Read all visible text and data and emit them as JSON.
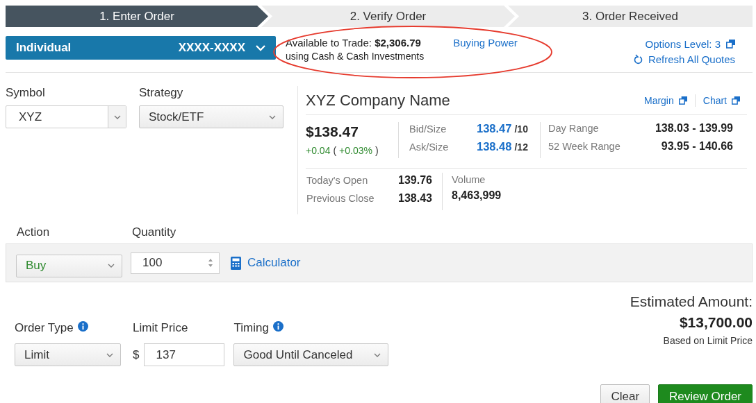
{
  "steps": [
    {
      "label": "1. Enter Order",
      "selected": true
    },
    {
      "label": "2. Verify Order",
      "selected": false
    },
    {
      "label": "3. Order Received",
      "selected": false
    }
  ],
  "account": {
    "type": "Individual",
    "number": "XXXX-XXXX"
  },
  "available": {
    "label": "Available to Trade:",
    "amount": "$2,306.79",
    "note": "using Cash & Cash Investments",
    "link": "Buying Power"
  },
  "options_level": "Options Level: 3",
  "refresh": "Refresh All Quotes",
  "symbol": {
    "label": "Symbol",
    "value": "XYZ"
  },
  "strategy": {
    "label": "Strategy",
    "value": "Stock/ETF"
  },
  "quote": {
    "name": "XYZ Company Name",
    "links": [
      "Margin",
      "Chart"
    ],
    "price": "$138.47",
    "change": "+0.04",
    "paren_open": "(",
    "change_pct": "+0.03%",
    "paren_close": ")",
    "bid_ask": [
      {
        "label": "Bid/Size",
        "price": "138.47",
        "size": "/10"
      },
      {
        "label": "Ask/Size",
        "price": "138.48",
        "size": "/12"
      }
    ],
    "ranges": [
      {
        "label": "Day Range",
        "value": "138.03 - 139.99"
      },
      {
        "label": "52 Week Range",
        "value": "93.95 - 140.66"
      }
    ],
    "open_close": [
      {
        "label": "Today's Open",
        "value": "139.76"
      },
      {
        "label": "Previous Close",
        "value": "138.43"
      }
    ],
    "volume": {
      "label": "Volume",
      "value": "8,463,999"
    }
  },
  "action": {
    "label": "Action",
    "value": "Buy"
  },
  "quantity": {
    "label": "Quantity",
    "value": "100"
  },
  "calculator": "Calculator",
  "order_type": {
    "label": "Order Type",
    "value": "Limit"
  },
  "limit_price": {
    "label": "Limit Price",
    "currency": "$",
    "value": "137"
  },
  "timing": {
    "label": "Timing",
    "value": "Good Until Canceled"
  },
  "estimate": {
    "label": "Estimated Amount:",
    "amount": "$13,700.00",
    "note": "Based on Limit Price"
  },
  "buttons": [
    {
      "label": "Clear",
      "kind": "secondary"
    },
    {
      "label": "Review Order",
      "kind": "primary"
    }
  ]
}
